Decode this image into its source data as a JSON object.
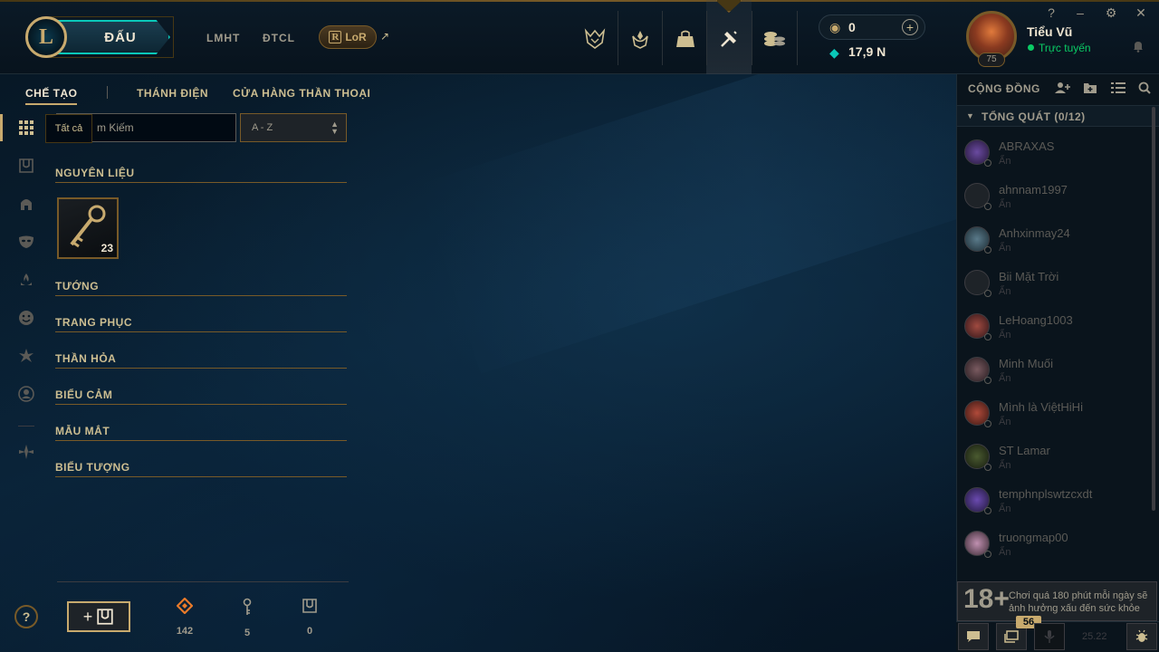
{
  "topbar": {
    "logo_text": "L",
    "play_label": "ĐẤU",
    "links": [
      "LMHT",
      "ĐTCL"
    ],
    "lor_label": "LoR",
    "lor_arrow": "↗",
    "rp_value": "0",
    "be_value": "17,9 N",
    "rp_add": "+"
  },
  "profile": {
    "name": "Tiểu Vũ",
    "status": "Trực tuyến",
    "level": "75",
    "window_controls": [
      "?",
      "–",
      "⚙",
      "✕"
    ]
  },
  "subnav": {
    "items": [
      "CHẾ TẠO",
      "THÁNH ĐIỆN",
      "CỬA HÀNG THẦN THOẠI"
    ]
  },
  "loot": {
    "tooltip": "Tất cả",
    "search_placeholder": "m Kiếm",
    "sort_value": "A - Z",
    "sections": [
      "NGUYÊN LIỆU",
      "TƯỚNG",
      "TRANG PHỤC",
      "THẦN HỎA",
      "BIỂU CẢM",
      "MẪU MẮT",
      "BIỂU TƯỢNG"
    ],
    "key_fragment_count": "23"
  },
  "bottom": {
    "help": "?",
    "stats": [
      "142",
      "5",
      "0"
    ]
  },
  "social": {
    "title": "CỘNG ĐỒNG",
    "group_label": "TỔNG QUÁT (0/12)",
    "friends": [
      {
        "name": "ABRAXAS",
        "status": "Ẩn"
      },
      {
        "name": "ahnnam1997",
        "status": "Ẩn"
      },
      {
        "name": "Anhxinmay24",
        "status": "Ẩn"
      },
      {
        "name": "Bii Mặt Trời",
        "status": "Ẩn"
      },
      {
        "name": "LeHoang1003",
        "status": "Ẩn"
      },
      {
        "name": "Minh Muối",
        "status": "Ẩn"
      },
      {
        "name": "Mình là ViệtHiHi",
        "status": "Ẩn"
      },
      {
        "name": "ST Lamar",
        "status": "Ẩn"
      },
      {
        "name": "temphnplswtzcxdt",
        "status": "Ẩn"
      },
      {
        "name": "truongmap00",
        "status": "Ẩn"
      }
    ],
    "warning_big": "18+",
    "warning_text": "Chơi quá 180 phút mỗi ngày sẽ ảnh hưởng xấu đến sức khỏe",
    "chat_badge": "56",
    "version": "25.22"
  },
  "colors": {
    "gold": "#c8aa6e",
    "teal": "#0ac8b9",
    "online": "#0acb65"
  }
}
